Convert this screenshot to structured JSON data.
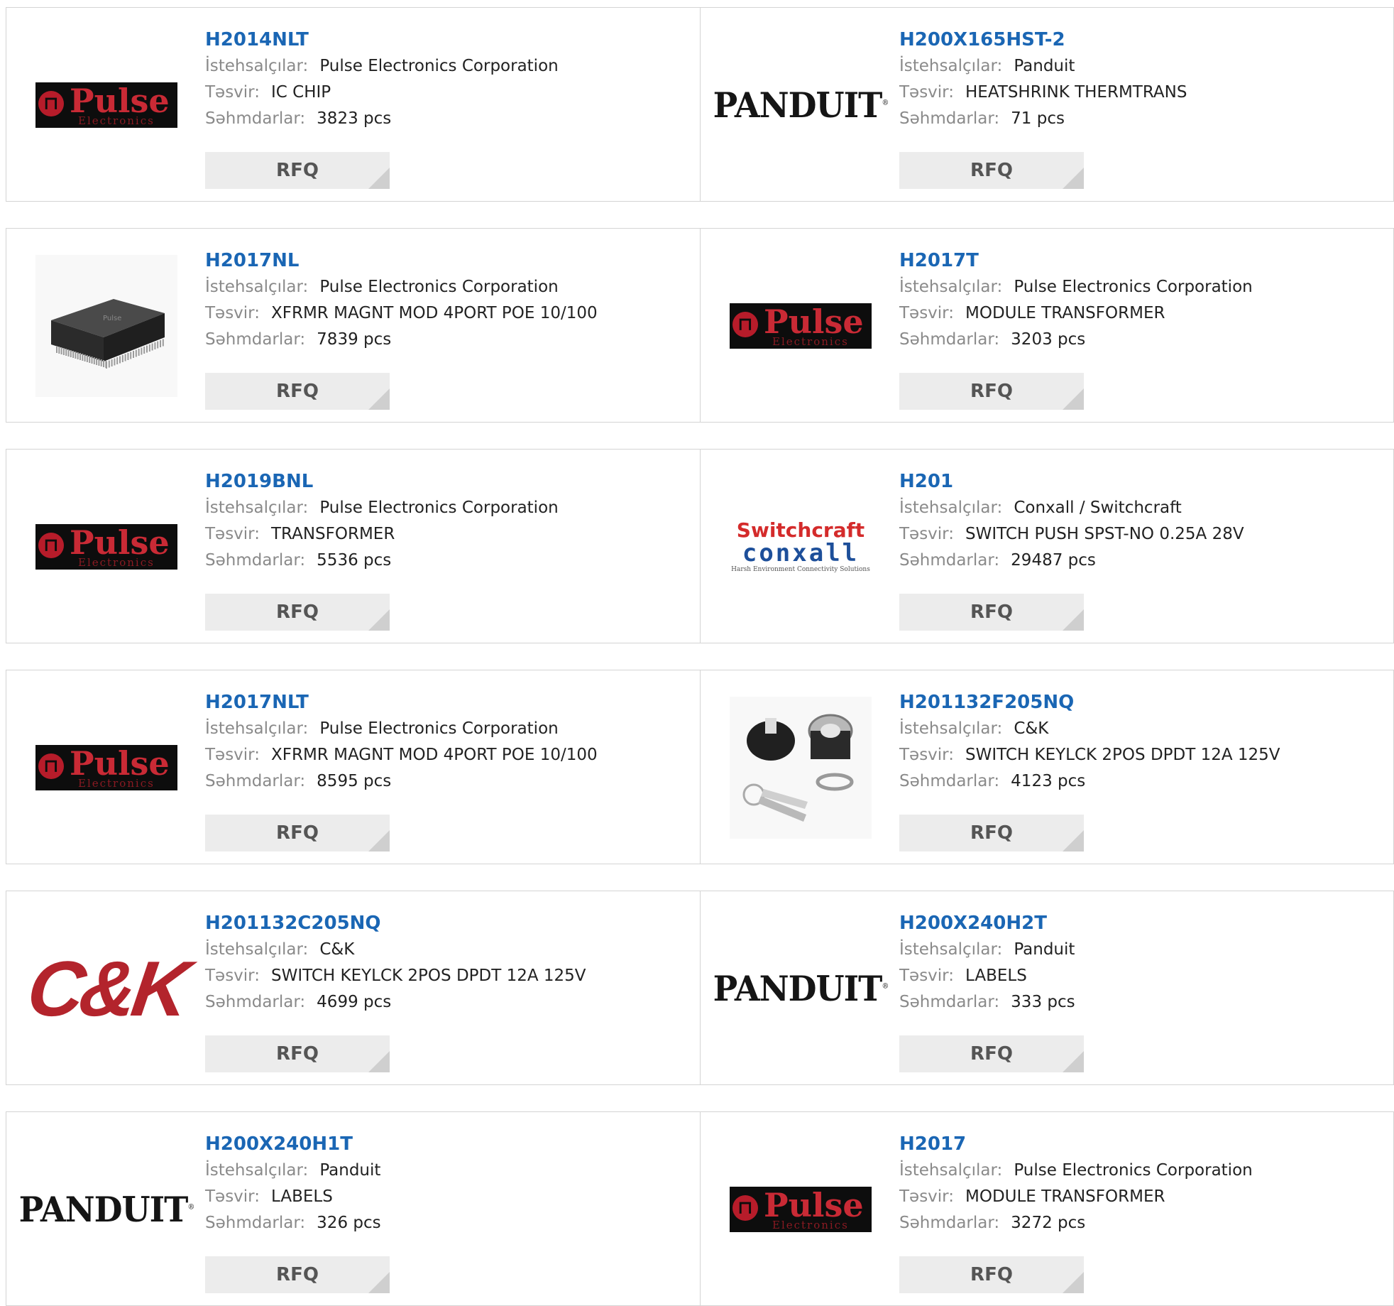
{
  "labels": {
    "manufacturer": "İstehsalçılar:",
    "description": "Təsvir:",
    "stock": "Səhmdarlar:",
    "rfq": "RFQ"
  },
  "products": [
    {
      "part": "H2014NLT",
      "manufacturer": "Pulse Electronics Corporation",
      "description": "IC CHIP",
      "stock": "3823 pcs",
      "logo": "pulse-electronics-logo"
    },
    {
      "part": "H200X165HST-2",
      "manufacturer": "Panduit",
      "description": "HEATSHRINK THERMTRANS",
      "stock": "71 pcs",
      "logo": "panduit-logo"
    },
    {
      "part": "H2017NL",
      "manufacturer": "Pulse Electronics Corporation",
      "description": "XFRMR MAGNT MOD 4PORT POE 10/100",
      "stock": "7839 pcs",
      "logo": "transformer-module-photo"
    },
    {
      "part": "H2017T",
      "manufacturer": "Pulse Electronics Corporation",
      "description": "MODULE TRANSFORMER",
      "stock": "3203 pcs",
      "logo": "pulse-electronics-logo"
    },
    {
      "part": "H2019BNL",
      "manufacturer": "Pulse Electronics Corporation",
      "description": "TRANSFORMER",
      "stock": "5536 pcs",
      "logo": "pulse-electronics-logo"
    },
    {
      "part": "H201",
      "manufacturer": "Conxall / Switchcraft",
      "description": "SWITCH PUSH SPST-NO 0.25A 28V",
      "stock": "29487 pcs",
      "logo": "switchcraft-conxall-logo"
    },
    {
      "part": "H2017NLT",
      "manufacturer": "Pulse Electronics Corporation",
      "description": "XFRMR MAGNT MOD 4PORT POE 10/100",
      "stock": "8595 pcs",
      "logo": "pulse-electronics-logo"
    },
    {
      "part": "H201132F205NQ",
      "manufacturer": "C&K",
      "description": "SWITCH KEYLCK 2POS DPDT 12A 125V",
      "stock": "4123 pcs",
      "logo": "keylock-switch-photo"
    },
    {
      "part": "H201132C205NQ",
      "manufacturer": "C&K",
      "description": "SWITCH KEYLCK 2POS DPDT 12A 125V",
      "stock": "4699 pcs",
      "logo": "ck-logo"
    },
    {
      "part": "H200X240H2T",
      "manufacturer": "Panduit",
      "description": "LABELS",
      "stock": "333 pcs",
      "logo": "panduit-logo"
    },
    {
      "part": "H200X240H1T",
      "manufacturer": "Panduit",
      "description": "LABELS",
      "stock": "326 pcs",
      "logo": "panduit-logo"
    },
    {
      "part": "H2017",
      "manufacturer": "Pulse Electronics Corporation",
      "description": "MODULE TRANSFORMER",
      "stock": "3272 pcs",
      "logo": "pulse-electronics-logo"
    }
  ],
  "logo_text": {
    "pulse": {
      "word": "Pulse",
      "sub": "Electronics"
    },
    "panduit": {
      "word": "PANDUIT"
    },
    "ck": {
      "word": "C&K"
    },
    "switchcraft": {
      "top": "Switchcraft",
      "bottom": "conxall",
      "tagline": "Harsh Environment Connectivity Solutions"
    }
  },
  "colors": {
    "link": "#1a66b4",
    "label": "#8a8a8a",
    "value": "#222222",
    "rfq_bg": "#ececec",
    "border": "#d4d4d4"
  }
}
